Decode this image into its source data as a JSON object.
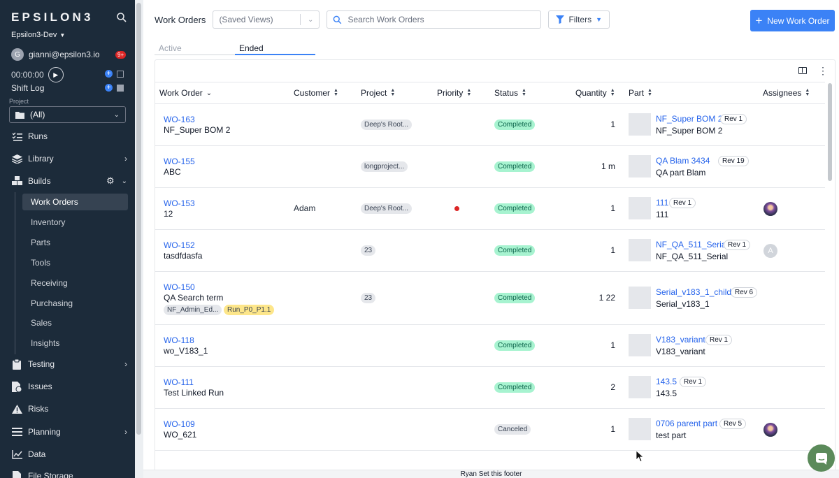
{
  "sidebar": {
    "logo": "EPSILON3",
    "workspace": "Epsilon3-Dev",
    "user_email": "gianni@epsilon3.io",
    "user_initial": "G",
    "notification_badge": "9+",
    "timer": "00:00:00",
    "shift_log": "Shift Log",
    "project_label": "Project",
    "project_value": "(All)",
    "nav": {
      "runs": "Runs",
      "library": "Library",
      "builds": "Builds",
      "testing": "Testing",
      "issues": "Issues",
      "risks": "Risks",
      "planning": "Planning",
      "data": "Data",
      "file_storage": "File Storage"
    },
    "builds_items": [
      "Work Orders",
      "Inventory",
      "Parts",
      "Tools",
      "Receiving",
      "Purchasing",
      "Sales",
      "Insights"
    ]
  },
  "toolbar": {
    "title": "Work Orders",
    "saved_views_placeholder": "(Saved Views)",
    "search_placeholder": "Search Work Orders",
    "filters_label": "Filters",
    "new_button_label": "New Work Order"
  },
  "tabs": {
    "active_tab": "Active",
    "ended_tab": "Ended"
  },
  "table": {
    "columns": {
      "work_order": "Work Order",
      "customer": "Customer",
      "project": "Project",
      "priority": "Priority",
      "status": "Status",
      "quantity": "Quantity",
      "part": "Part",
      "assignees": "Assignees"
    },
    "rows": [
      {
        "id": "WO-163",
        "name": "NF_Super BOM 2",
        "customer": "",
        "project": "Deep's Root...",
        "status": "Completed",
        "quantity": "1",
        "part": "NF_Super BOM 2",
        "rev": "Rev 1",
        "part_name": "NF_Super BOM 2"
      },
      {
        "id": "WO-155",
        "name": "ABC",
        "customer": "",
        "project": "longproject...",
        "status": "Completed",
        "quantity": "1 m",
        "part": "QA Blam 3434",
        "rev": "Rev 19",
        "part_name": "QA part Blam"
      },
      {
        "id": "WO-153",
        "name": "12",
        "customer": "Adam",
        "project": "Deep's Root...",
        "priority": "high",
        "status": "Completed",
        "quantity": "1",
        "part": "111",
        "rev": "Rev 1",
        "part_name": "111",
        "assignee": "photo"
      },
      {
        "id": "WO-152",
        "name": "tasdfdasfa",
        "customer": "",
        "project": "23",
        "status": "Completed",
        "quantity": "1",
        "part": "NF_QA_511_Serial",
        "rev": "Rev 1",
        "part_name": "NF_QA_511_Serial",
        "assignee": "A"
      },
      {
        "id": "WO-150",
        "name": "QA Search term",
        "customer": "",
        "project": "23",
        "tags": [
          "NF_Admin_Ed...",
          "Run_P0_P1.1"
        ],
        "status": "Completed",
        "quantity": "1 22",
        "part": "Serial_v183_1_child",
        "rev": "Rev 6",
        "part_name": "Serial_v183_1"
      },
      {
        "id": "WO-118",
        "name": "wo_V183_1",
        "customer": "",
        "project": "",
        "status": "Completed",
        "quantity": "1",
        "part": "V183_variant",
        "rev": "Rev 1",
        "part_name": "V183_variant"
      },
      {
        "id": "WO-111",
        "name": "Test Linked Run",
        "customer": "",
        "project": "",
        "status": "Completed",
        "quantity": "2",
        "part": "143.5",
        "rev": "Rev 1",
        "part_name": "143.5"
      },
      {
        "id": "WO-109",
        "name": "WO_621",
        "customer": "",
        "project": "",
        "status": "Canceled",
        "quantity": "1",
        "part": "0706 parent part",
        "rev": "Rev 5",
        "part_name": "test part",
        "assignee": "photo"
      }
    ]
  },
  "footer": "Ryan Set this footer",
  "colors": {
    "sidebar_bg": "#1c2b3a",
    "accent": "#3b82f6",
    "completed": "#a7f3d0",
    "link": "#2563eb"
  }
}
